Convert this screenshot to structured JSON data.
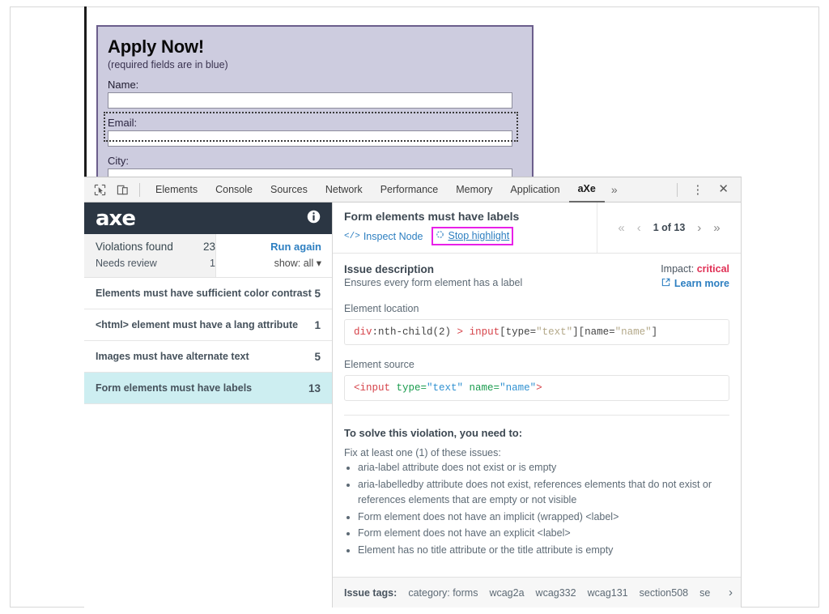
{
  "webpage": {
    "form": {
      "title": "Apply Now!",
      "subtitle": "(required fields are in blue)",
      "fields": [
        {
          "label": "Name:",
          "value": "",
          "required": true
        },
        {
          "label": "Email:",
          "value": "",
          "required": false
        },
        {
          "label": "City:",
          "value": "",
          "required": false
        }
      ]
    }
  },
  "devtools": {
    "toolbar": {
      "inspect_icon": "inspect-element-icon",
      "device_icon": "device-toolbar-icon",
      "tabs": [
        "Elements",
        "Console",
        "Sources",
        "Network",
        "Performance",
        "Memory",
        "Application",
        "aXe"
      ],
      "active_tab": "aXe",
      "more_tabs": "»",
      "kebab": "⋮",
      "close": "✕"
    },
    "axe_panel": {
      "brand": "axe",
      "info_icon": "info-icon",
      "summary": {
        "violations_label": "Violations found",
        "violations_count": "23",
        "needs_review_label": "Needs review",
        "needs_review_count": "1",
        "run_again": "Run again",
        "show_filter": "show: all"
      },
      "violations": [
        {
          "name": "Elements must have sufficient color contrast",
          "count": "5",
          "selected": false
        },
        {
          "name": "<html> element must have a lang attribute",
          "count": "1",
          "selected": false
        },
        {
          "name": "Images must have alternate text",
          "count": "5",
          "selected": false
        },
        {
          "name": "Form elements must have labels",
          "count": "13",
          "selected": true
        }
      ]
    },
    "detail": {
      "title": "Form elements must have labels",
      "inspect_node": "Inspect Node",
      "inspect_glyph": "</>",
      "stop_highlight": "Stop highlight",
      "stop_highlight_icon": "highlight-target-icon",
      "nav": {
        "first": "«",
        "prev": "‹",
        "counter": "1 of 13",
        "next": "›",
        "last": "»"
      },
      "issue_description_label": "Issue description",
      "issue_description_text": "Ensures every form element has a label",
      "impact_label": "Impact:",
      "impact_value": "critical",
      "learn_more": "Learn more",
      "learn_more_icon": "external-link-icon",
      "element_location_label": "Element location",
      "element_location": {
        "t1": "div",
        "t2": ":nth-child(2)",
        "t3": " > ",
        "t4": "input",
        "t5": "[",
        "t6": "type=",
        "t7": "\"text\"",
        "t8": "][",
        "t9": "name=",
        "t10": "\"name\"",
        "t11": "]"
      },
      "element_source_label": "Element source",
      "element_source": {
        "s1": "<input",
        "s2": " type=",
        "s3": "\"text\"",
        "s4": " name=",
        "s5": "\"name\"",
        "s6": ">"
      },
      "solve_title": "To solve this violation, you need to:",
      "solve_lead": "Fix at least one (1) of these issues:",
      "solve_items": [
        "aria-label attribute does not exist or is empty",
        "aria-labelledby attribute does not exist, references elements that do not exist or references elements that are empty or not visible",
        "Form element does not have an implicit (wrapped) <label>",
        "Form element does not have an explicit <label>",
        "Element has no title attribute or the title attribute is empty"
      ],
      "issue_tags_label": "Issue tags:",
      "issue_tags": [
        "category: forms",
        "wcag2a",
        "wcag332",
        "wcag131",
        "section508",
        "se"
      ],
      "tags_next": "›"
    }
  },
  "colors": {
    "axe_brand_bg": "#2b3643",
    "selected_row": "#cdeef1",
    "link": "#2d7fc1",
    "critical": "#e03055",
    "highlight_box": "#e820e8",
    "form_bg": "#cdccdf",
    "form_border": "#6b5e8c"
  }
}
